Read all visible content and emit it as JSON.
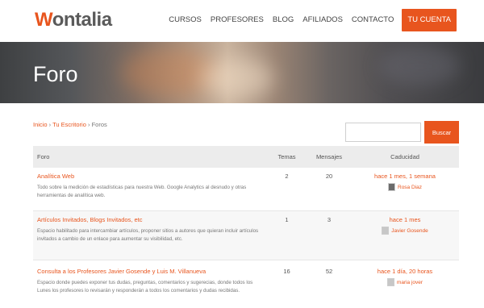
{
  "brand": {
    "logo_first": "W",
    "logo_rest": "ontalia"
  },
  "nav": {
    "items": [
      "CURSOS",
      "PROFESORES",
      "BLOG",
      "AFILIADOS",
      "CONTACTO"
    ],
    "cta": "TU CUENTA"
  },
  "hero": {
    "title": "Foro"
  },
  "breadcrumb": {
    "home": "Inicio",
    "sep": "›",
    "desk": "Tu Escritorio",
    "current": "Foros"
  },
  "search": {
    "value": "",
    "button": "Buscar"
  },
  "table": {
    "headers": {
      "forum": "Foro",
      "topics": "Temas",
      "posts": "Mensajes",
      "freshness": "Caducidad"
    },
    "rows": [
      {
        "title": "Analítica Web",
        "description": "Todo sobre la medición de estadísticas para nuestra Web. Google Analytics al desnudo y otras herramientas de analítica web.",
        "topics": "2",
        "posts": "20",
        "freshness": "hace 1 mes, 1 semana",
        "author": "Rosa Diaz"
      },
      {
        "title": "Artículos Invitados, Blogs Invitados, etc",
        "description": "Espacio habilitado para intercambiar artículos, proponer sitios a autores que quieran incluir artículos invitados a cambio de un enlace para aumentar su visibilidad, etc.",
        "topics": "1",
        "posts": "3",
        "freshness": "hace 1 mes",
        "author": "Javier Gosende"
      },
      {
        "title": "Consulta a los Profesores Javier Gosende y Luis M. Villanueva",
        "description": "Espacio donde puedes exponer tus dudas, preguntas, comentarios y sugerecias, donde todos los Lunes los profesores lo revisarán y responderán a todos los comentarios y dudas recibidas.",
        "topics": "16",
        "posts": "52",
        "freshness": "hace 1 día, 20 horas",
        "author": "maria jover"
      }
    ]
  },
  "colors": {
    "accent": "#e8551e",
    "header_row": "#ececec",
    "alt_row": "#f7f7f7"
  }
}
